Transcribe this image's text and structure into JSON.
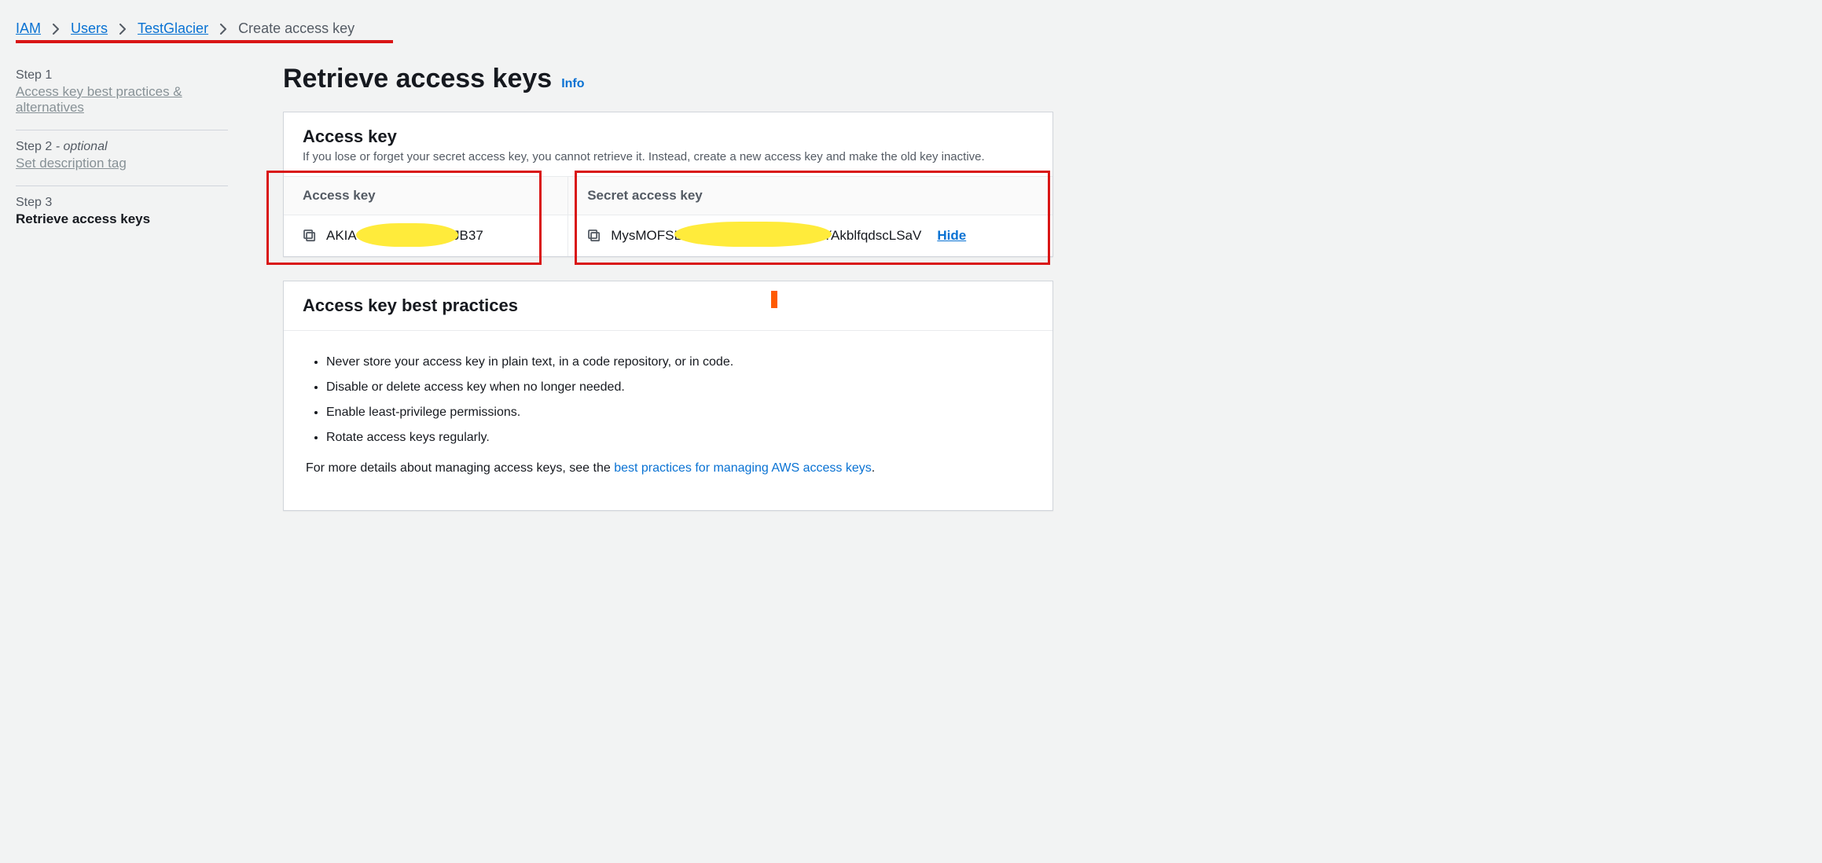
{
  "breadcrumb": {
    "items": [
      "IAM",
      "Users",
      "TestGlacier"
    ],
    "current": "Create access key"
  },
  "wizard": {
    "step1_label": "Step 1",
    "step1_title": "Access key best practices & alternatives",
    "step2_label": "Step 2",
    "step2_optional": " - optional",
    "step2_title": "Set description tag",
    "step3_label": "Step 3",
    "step3_title": "Retrieve access keys"
  },
  "main": {
    "title": "Retrieve access keys",
    "info": "Info"
  },
  "access_card": {
    "title": "Access key",
    "subtitle": "If you lose or forget your secret access key, you cannot retrieve it. Instead, create a new access key and make the old key inactive.",
    "col1_head": "Access key",
    "col1_value_prefix": "AKIA",
    "col1_value_suffix": "HJB37",
    "col2_head": "Secret access key",
    "col2_value_prefix": "MysMOFSL",
    "col2_value_suffix": "YAkblfqdscLSaV",
    "hide": "Hide"
  },
  "best_practices": {
    "title": "Access key best practices",
    "items": [
      "Never store your access key in plain text, in a code repository, or in code.",
      "Disable or delete access key when no longer needed.",
      "Enable least-privilege permissions.",
      "Rotate access keys regularly."
    ],
    "more_prefix": "For more details about managing access keys, see the ",
    "more_link": "best practices for managing AWS access keys",
    "more_suffix": "."
  }
}
